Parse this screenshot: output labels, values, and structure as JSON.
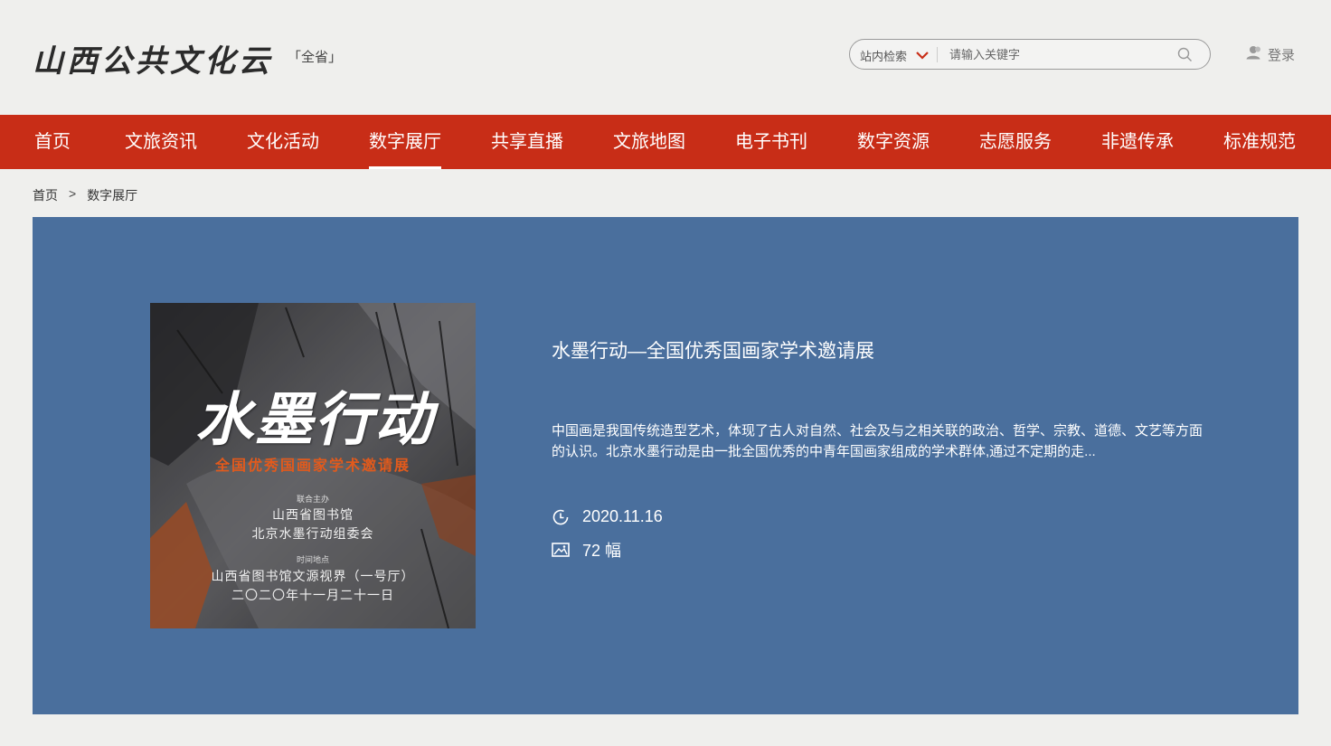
{
  "header": {
    "logo_text": "山西公共文化云",
    "scope_label": "「全省」",
    "search": {
      "scope": "站内检索",
      "placeholder": "请输入关键字",
      "value": ""
    },
    "login_label": "登录"
  },
  "nav": {
    "items": [
      {
        "label": "首页"
      },
      {
        "label": "文旅资讯"
      },
      {
        "label": "文化活动"
      },
      {
        "label": "数字展厅",
        "active": true
      },
      {
        "label": "共享直播"
      },
      {
        "label": "文旅地图"
      },
      {
        "label": "电子书刊"
      },
      {
        "label": "数字资源"
      },
      {
        "label": "志愿服务"
      },
      {
        "label": "非遗传承"
      },
      {
        "label": "标准规范"
      }
    ]
  },
  "breadcrumb": {
    "home": "首页",
    "separator": ">",
    "current": "数字展厅"
  },
  "exhibit": {
    "poster": {
      "title": "水墨行动",
      "subtitle": "全国优秀国画家学术邀请展",
      "organizer_label": "联合主办",
      "organizer_1": "山西省图书馆",
      "organizer_2": "北京水墨行动组委会",
      "venue_label": "时间地点",
      "venue": "山西省图书馆文源视界（一号厅）",
      "date": "二〇二〇年十一月二十一日"
    },
    "title": "水墨行动—全国优秀国画家学术邀请展",
    "description": "中国画是我国传统造型艺术，体现了古人对自然、社会及与之相关联的政治、哲学、宗教、道德、文艺等方面的认识。北京水墨行动是由一批全国优秀的中青年国画家组成的学术群体,通过不定期的走...",
    "date": "2020.11.16",
    "image_count": "72 幅"
  },
  "colors": {
    "nav_red": "#c82d17",
    "panel_blue": "#4a6f9d",
    "page_bg": "#efefed"
  }
}
